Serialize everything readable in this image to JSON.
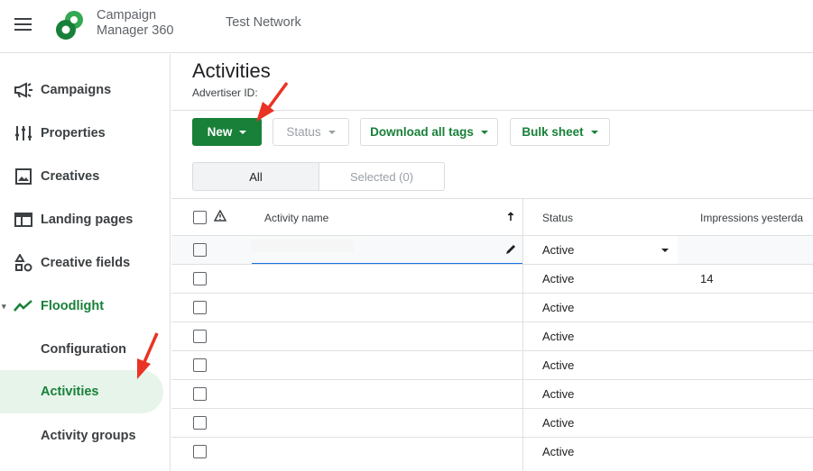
{
  "app": {
    "brand_line1": "Campaign",
    "brand_line2": "Manager 360",
    "network": "Test Network"
  },
  "colors": {
    "accent": "#188038",
    "active_bg": "#e6f4ea",
    "arrow": "#ea3323"
  },
  "sidebar": {
    "items": [
      {
        "label": "Campaigns",
        "icon": "megaphone-icon"
      },
      {
        "label": "Properties",
        "icon": "sliders-icon"
      },
      {
        "label": "Creatives",
        "icon": "image-icon"
      },
      {
        "label": "Landing pages",
        "icon": "web-page-icon"
      },
      {
        "label": "Creative fields",
        "icon": "shapes-icon"
      },
      {
        "label": "Floodlight",
        "icon": "trending-icon"
      },
      {
        "label": "Configuration"
      },
      {
        "label": "Activities"
      },
      {
        "label": "Activity groups"
      }
    ]
  },
  "main": {
    "title": "Activities",
    "advertiser_label": "Advertiser ID:",
    "toolbar": {
      "new": "New",
      "status": "Status",
      "download": "Download all tags",
      "bulk": "Bulk sheet"
    },
    "tabs": {
      "all": "All",
      "selected": "Selected (0)"
    },
    "table": {
      "columns": [
        "Activity name",
        "Status",
        "Impressions yesterda"
      ],
      "rows": [
        {
          "status": "Active",
          "impressions": ""
        },
        {
          "status": "Active",
          "impressions": "14"
        },
        {
          "status": "Active",
          "impressions": ""
        },
        {
          "status": "Active",
          "impressions": ""
        },
        {
          "status": "Active",
          "impressions": ""
        },
        {
          "status": "Active",
          "impressions": ""
        },
        {
          "status": "Active",
          "impressions": ""
        },
        {
          "status": "Active",
          "impressions": ""
        }
      ]
    }
  }
}
